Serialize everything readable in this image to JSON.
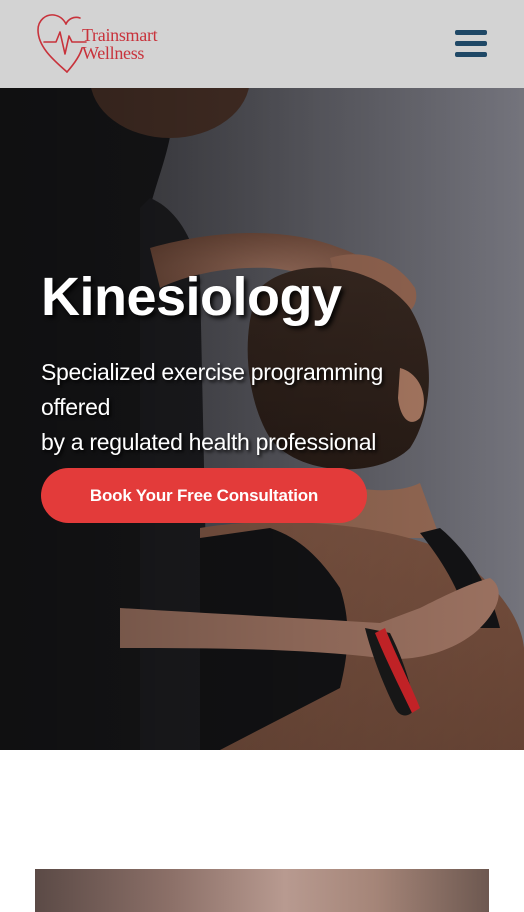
{
  "header": {
    "logo": {
      "line1": "Trainsmart",
      "line2": "Wellness",
      "icon": "heart-heartbeat-icon",
      "color": "#c8323b"
    },
    "menu_icon": "hamburger-menu-icon",
    "menu_color": "#1f4866",
    "background": "#d3d3d3"
  },
  "hero": {
    "title": "Kinesiology",
    "subtitle_lines": [
      "Specialized exercise programming",
      "offered",
      "by a regulated health professional"
    ],
    "cta_label": "Book Your Free Consultation",
    "cta_color": "#e33b3a",
    "image": "therapist-assessing-patient-neck-photo"
  },
  "section": {
    "image": "section-photo"
  }
}
